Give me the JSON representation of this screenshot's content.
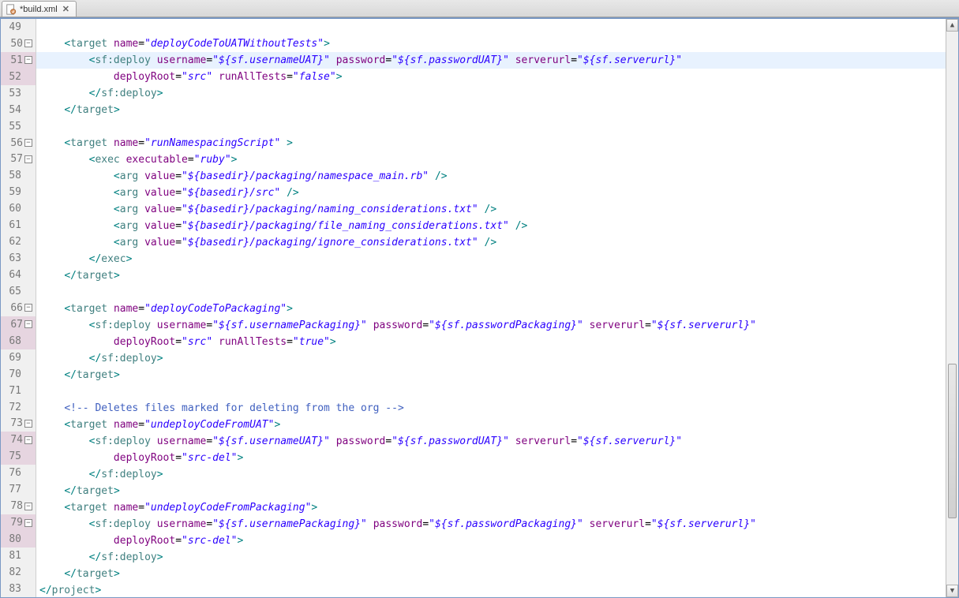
{
  "tab": {
    "label": "*build.xml"
  },
  "gutter": [
    {
      "n": "49",
      "fold": false,
      "dirty": false
    },
    {
      "n": "50",
      "fold": true,
      "dirty": false
    },
    {
      "n": "51",
      "fold": true,
      "dirty": true
    },
    {
      "n": "52",
      "fold": false,
      "dirty": true
    },
    {
      "n": "53",
      "fold": false,
      "dirty": false
    },
    {
      "n": "54",
      "fold": false,
      "dirty": false
    },
    {
      "n": "55",
      "fold": false,
      "dirty": false
    },
    {
      "n": "56",
      "fold": true,
      "dirty": false
    },
    {
      "n": "57",
      "fold": true,
      "dirty": false
    },
    {
      "n": "58",
      "fold": false,
      "dirty": false
    },
    {
      "n": "59",
      "fold": false,
      "dirty": false
    },
    {
      "n": "60",
      "fold": false,
      "dirty": false
    },
    {
      "n": "61",
      "fold": false,
      "dirty": false
    },
    {
      "n": "62",
      "fold": false,
      "dirty": false
    },
    {
      "n": "63",
      "fold": false,
      "dirty": false
    },
    {
      "n": "64",
      "fold": false,
      "dirty": false
    },
    {
      "n": "65",
      "fold": false,
      "dirty": false
    },
    {
      "n": "66",
      "fold": true,
      "dirty": false
    },
    {
      "n": "67",
      "fold": true,
      "dirty": true
    },
    {
      "n": "68",
      "fold": false,
      "dirty": true
    },
    {
      "n": "69",
      "fold": false,
      "dirty": false
    },
    {
      "n": "70",
      "fold": false,
      "dirty": false
    },
    {
      "n": "71",
      "fold": false,
      "dirty": false
    },
    {
      "n": "72",
      "fold": false,
      "dirty": false
    },
    {
      "n": "73",
      "fold": true,
      "dirty": false
    },
    {
      "n": "74",
      "fold": true,
      "dirty": true
    },
    {
      "n": "75",
      "fold": false,
      "dirty": true
    },
    {
      "n": "76",
      "fold": false,
      "dirty": false
    },
    {
      "n": "77",
      "fold": false,
      "dirty": false
    },
    {
      "n": "78",
      "fold": true,
      "dirty": false
    },
    {
      "n": "79",
      "fold": true,
      "dirty": true
    },
    {
      "n": "80",
      "fold": false,
      "dirty": true
    },
    {
      "n": "81",
      "fold": false,
      "dirty": false
    },
    {
      "n": "82",
      "fold": false,
      "dirty": false
    },
    {
      "n": "83",
      "fold": false,
      "dirty": false
    }
  ],
  "code": {
    "highlightIndex": 2,
    "lines": [
      [],
      [
        {
          "t": "plain",
          "v": "    "
        },
        {
          "t": "sym",
          "v": "<"
        },
        {
          "t": "tag",
          "v": "target "
        },
        {
          "t": "attr",
          "v": "name"
        },
        {
          "t": "plain",
          "v": "="
        },
        {
          "t": "val",
          "v": "\"deployCodeToUATWithoutTests\""
        },
        {
          "t": "sym",
          "v": ">"
        }
      ],
      [
        {
          "t": "plain",
          "v": "        "
        },
        {
          "t": "sym",
          "v": "<"
        },
        {
          "t": "tag",
          "v": "sf:deploy "
        },
        {
          "t": "attr",
          "v": "username"
        },
        {
          "t": "plain",
          "v": "="
        },
        {
          "t": "val",
          "v": "\"${sf.usernameUAT}\""
        },
        {
          "t": "plain",
          "v": " "
        },
        {
          "t": "attr",
          "v": "password"
        },
        {
          "t": "plain",
          "v": "="
        },
        {
          "t": "val",
          "v": "\"${sf.passwordUAT}\""
        },
        {
          "t": "plain",
          "v": " "
        },
        {
          "t": "attr",
          "v": "serverurl"
        },
        {
          "t": "plain",
          "v": "="
        },
        {
          "t": "val",
          "v": "\"${sf.serverurl}\""
        }
      ],
      [
        {
          "t": "plain",
          "v": "            "
        },
        {
          "t": "attr",
          "v": "deployRoot"
        },
        {
          "t": "plain",
          "v": "="
        },
        {
          "t": "val",
          "v": "\"src\""
        },
        {
          "t": "plain",
          "v": " "
        },
        {
          "t": "attr",
          "v": "runAllTests"
        },
        {
          "t": "plain",
          "v": "="
        },
        {
          "t": "val",
          "v": "\"false\""
        },
        {
          "t": "sym",
          "v": ">"
        }
      ],
      [
        {
          "t": "plain",
          "v": "        "
        },
        {
          "t": "sym",
          "v": "</"
        },
        {
          "t": "tag",
          "v": "sf:deploy"
        },
        {
          "t": "sym",
          "v": ">"
        }
      ],
      [
        {
          "t": "plain",
          "v": "    "
        },
        {
          "t": "sym",
          "v": "</"
        },
        {
          "t": "tag",
          "v": "target"
        },
        {
          "t": "sym",
          "v": ">"
        }
      ],
      [],
      [
        {
          "t": "plain",
          "v": "    "
        },
        {
          "t": "sym",
          "v": "<"
        },
        {
          "t": "tag",
          "v": "target "
        },
        {
          "t": "attr",
          "v": "name"
        },
        {
          "t": "plain",
          "v": "="
        },
        {
          "t": "val",
          "v": "\"runNamespacingScript\""
        },
        {
          "t": "plain",
          "v": " "
        },
        {
          "t": "sym",
          "v": ">"
        }
      ],
      [
        {
          "t": "plain",
          "v": "        "
        },
        {
          "t": "sym",
          "v": "<"
        },
        {
          "t": "tag",
          "v": "exec "
        },
        {
          "t": "attr",
          "v": "executable"
        },
        {
          "t": "plain",
          "v": "="
        },
        {
          "t": "val",
          "v": "\"ruby\""
        },
        {
          "t": "sym",
          "v": ">"
        }
      ],
      [
        {
          "t": "plain",
          "v": "            "
        },
        {
          "t": "sym",
          "v": "<"
        },
        {
          "t": "tag",
          "v": "arg "
        },
        {
          "t": "attr",
          "v": "value"
        },
        {
          "t": "plain",
          "v": "="
        },
        {
          "t": "val",
          "v": "\"${basedir}/packaging/namespace_main.rb\""
        },
        {
          "t": "plain",
          "v": " "
        },
        {
          "t": "sym",
          "v": "/>"
        }
      ],
      [
        {
          "t": "plain",
          "v": "            "
        },
        {
          "t": "sym",
          "v": "<"
        },
        {
          "t": "tag",
          "v": "arg "
        },
        {
          "t": "attr",
          "v": "value"
        },
        {
          "t": "plain",
          "v": "="
        },
        {
          "t": "val",
          "v": "\"${basedir}/src\""
        },
        {
          "t": "plain",
          "v": " "
        },
        {
          "t": "sym",
          "v": "/>"
        }
      ],
      [
        {
          "t": "plain",
          "v": "            "
        },
        {
          "t": "sym",
          "v": "<"
        },
        {
          "t": "tag",
          "v": "arg "
        },
        {
          "t": "attr",
          "v": "value"
        },
        {
          "t": "plain",
          "v": "="
        },
        {
          "t": "val",
          "v": "\"${basedir}/packaging/naming_considerations.txt\""
        },
        {
          "t": "plain",
          "v": " "
        },
        {
          "t": "sym",
          "v": "/>"
        }
      ],
      [
        {
          "t": "plain",
          "v": "            "
        },
        {
          "t": "sym",
          "v": "<"
        },
        {
          "t": "tag",
          "v": "arg "
        },
        {
          "t": "attr",
          "v": "value"
        },
        {
          "t": "plain",
          "v": "="
        },
        {
          "t": "val",
          "v": "\"${basedir}/packaging/file_naming_considerations.txt\""
        },
        {
          "t": "plain",
          "v": " "
        },
        {
          "t": "sym",
          "v": "/>"
        }
      ],
      [
        {
          "t": "plain",
          "v": "            "
        },
        {
          "t": "sym",
          "v": "<"
        },
        {
          "t": "tag",
          "v": "arg "
        },
        {
          "t": "attr",
          "v": "value"
        },
        {
          "t": "plain",
          "v": "="
        },
        {
          "t": "val",
          "v": "\"${basedir}/packaging/ignore_considerations.txt\""
        },
        {
          "t": "plain",
          "v": " "
        },
        {
          "t": "sym",
          "v": "/>"
        }
      ],
      [
        {
          "t": "plain",
          "v": "        "
        },
        {
          "t": "sym",
          "v": "</"
        },
        {
          "t": "tag",
          "v": "exec"
        },
        {
          "t": "sym",
          "v": ">"
        }
      ],
      [
        {
          "t": "plain",
          "v": "    "
        },
        {
          "t": "sym",
          "v": "</"
        },
        {
          "t": "tag",
          "v": "target"
        },
        {
          "t": "sym",
          "v": ">"
        }
      ],
      [],
      [
        {
          "t": "plain",
          "v": "    "
        },
        {
          "t": "sym",
          "v": "<"
        },
        {
          "t": "tag",
          "v": "target "
        },
        {
          "t": "attr",
          "v": "name"
        },
        {
          "t": "plain",
          "v": "="
        },
        {
          "t": "val",
          "v": "\"deployCodeToPackaging\""
        },
        {
          "t": "sym",
          "v": ">"
        }
      ],
      [
        {
          "t": "plain",
          "v": "        "
        },
        {
          "t": "sym",
          "v": "<"
        },
        {
          "t": "tag",
          "v": "sf:deploy "
        },
        {
          "t": "attr",
          "v": "username"
        },
        {
          "t": "plain",
          "v": "="
        },
        {
          "t": "val",
          "v": "\"${sf.usernamePackaging}\""
        },
        {
          "t": "plain",
          "v": " "
        },
        {
          "t": "attr",
          "v": "password"
        },
        {
          "t": "plain",
          "v": "="
        },
        {
          "t": "val",
          "v": "\"${sf.passwordPackaging}\""
        },
        {
          "t": "plain",
          "v": " "
        },
        {
          "t": "attr",
          "v": "serverurl"
        },
        {
          "t": "plain",
          "v": "="
        },
        {
          "t": "val",
          "v": "\"${sf.serverurl}\""
        }
      ],
      [
        {
          "t": "plain",
          "v": "            "
        },
        {
          "t": "attr",
          "v": "deployRoot"
        },
        {
          "t": "plain",
          "v": "="
        },
        {
          "t": "val",
          "v": "\"src\""
        },
        {
          "t": "plain",
          "v": " "
        },
        {
          "t": "attr",
          "v": "runAllTests"
        },
        {
          "t": "plain",
          "v": "="
        },
        {
          "t": "val",
          "v": "\"true\""
        },
        {
          "t": "sym",
          "v": ">"
        }
      ],
      [
        {
          "t": "plain",
          "v": "        "
        },
        {
          "t": "sym",
          "v": "</"
        },
        {
          "t": "tag",
          "v": "sf:deploy"
        },
        {
          "t": "sym",
          "v": ">"
        }
      ],
      [
        {
          "t": "plain",
          "v": "    "
        },
        {
          "t": "sym",
          "v": "</"
        },
        {
          "t": "tag",
          "v": "target"
        },
        {
          "t": "sym",
          "v": ">"
        }
      ],
      [],
      [
        {
          "t": "plain",
          "v": "    "
        },
        {
          "t": "cmt",
          "v": "<!-- Deletes files marked for deleting from the org -->"
        }
      ],
      [
        {
          "t": "plain",
          "v": "    "
        },
        {
          "t": "sym",
          "v": "<"
        },
        {
          "t": "tag",
          "v": "target "
        },
        {
          "t": "attr",
          "v": "name"
        },
        {
          "t": "plain",
          "v": "="
        },
        {
          "t": "val",
          "v": "\"undeployCodeFromUAT\""
        },
        {
          "t": "sym",
          "v": ">"
        }
      ],
      [
        {
          "t": "plain",
          "v": "        "
        },
        {
          "t": "sym",
          "v": "<"
        },
        {
          "t": "tag",
          "v": "sf:deploy "
        },
        {
          "t": "attr",
          "v": "username"
        },
        {
          "t": "plain",
          "v": "="
        },
        {
          "t": "val",
          "v": "\"${sf.usernameUAT}\""
        },
        {
          "t": "plain",
          "v": " "
        },
        {
          "t": "attr",
          "v": "password"
        },
        {
          "t": "plain",
          "v": "="
        },
        {
          "t": "val",
          "v": "\"${sf.passwordUAT}\""
        },
        {
          "t": "plain",
          "v": " "
        },
        {
          "t": "attr",
          "v": "serverurl"
        },
        {
          "t": "plain",
          "v": "="
        },
        {
          "t": "val",
          "v": "\"${sf.serverurl}\""
        }
      ],
      [
        {
          "t": "plain",
          "v": "            "
        },
        {
          "t": "attr",
          "v": "deployRoot"
        },
        {
          "t": "plain",
          "v": "="
        },
        {
          "t": "val",
          "v": "\"src-del\""
        },
        {
          "t": "sym",
          "v": ">"
        }
      ],
      [
        {
          "t": "plain",
          "v": "        "
        },
        {
          "t": "sym",
          "v": "</"
        },
        {
          "t": "tag",
          "v": "sf:deploy"
        },
        {
          "t": "sym",
          "v": ">"
        }
      ],
      [
        {
          "t": "plain",
          "v": "    "
        },
        {
          "t": "sym",
          "v": "</"
        },
        {
          "t": "tag",
          "v": "target"
        },
        {
          "t": "sym",
          "v": ">"
        }
      ],
      [
        {
          "t": "plain",
          "v": "    "
        },
        {
          "t": "sym",
          "v": "<"
        },
        {
          "t": "tag",
          "v": "target "
        },
        {
          "t": "attr",
          "v": "name"
        },
        {
          "t": "plain",
          "v": "="
        },
        {
          "t": "val",
          "v": "\"undeployCodeFromPackaging\""
        },
        {
          "t": "sym",
          "v": ">"
        }
      ],
      [
        {
          "t": "plain",
          "v": "        "
        },
        {
          "t": "sym",
          "v": "<"
        },
        {
          "t": "tag",
          "v": "sf:deploy "
        },
        {
          "t": "attr",
          "v": "username"
        },
        {
          "t": "plain",
          "v": "="
        },
        {
          "t": "val",
          "v": "\"${sf.usernamePackaging}\""
        },
        {
          "t": "plain",
          "v": " "
        },
        {
          "t": "attr",
          "v": "password"
        },
        {
          "t": "plain",
          "v": "="
        },
        {
          "t": "val",
          "v": "\"${sf.passwordPackaging}\""
        },
        {
          "t": "plain",
          "v": " "
        },
        {
          "t": "attr",
          "v": "serverurl"
        },
        {
          "t": "plain",
          "v": "="
        },
        {
          "t": "val",
          "v": "\"${sf.serverurl}\""
        }
      ],
      [
        {
          "t": "plain",
          "v": "            "
        },
        {
          "t": "attr",
          "v": "deployRoot"
        },
        {
          "t": "plain",
          "v": "="
        },
        {
          "t": "val",
          "v": "\"src-del\""
        },
        {
          "t": "sym",
          "v": ">"
        }
      ],
      [
        {
          "t": "plain",
          "v": "        "
        },
        {
          "t": "sym",
          "v": "</"
        },
        {
          "t": "tag",
          "v": "sf:deploy"
        },
        {
          "t": "sym",
          "v": ">"
        }
      ],
      [
        {
          "t": "plain",
          "v": "    "
        },
        {
          "t": "sym",
          "v": "</"
        },
        {
          "t": "tag",
          "v": "target"
        },
        {
          "t": "sym",
          "v": ">"
        }
      ],
      [
        {
          "t": "sym",
          "v": "</"
        },
        {
          "t": "tag",
          "v": "project"
        },
        {
          "t": "sym",
          "v": ">"
        }
      ]
    ]
  }
}
